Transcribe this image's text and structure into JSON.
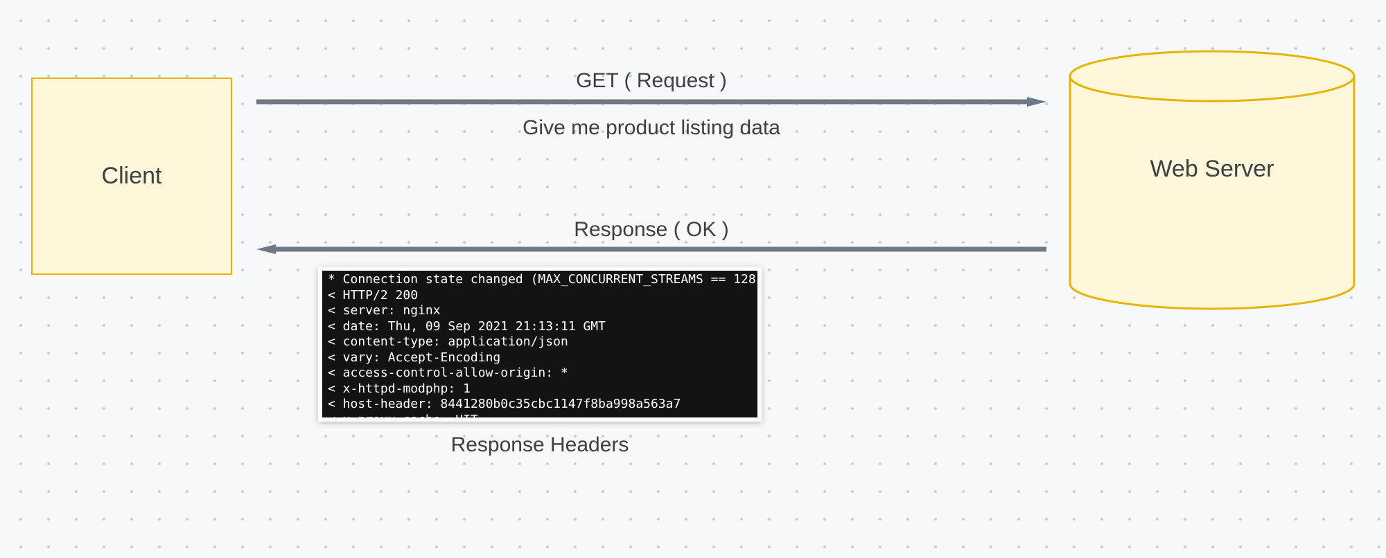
{
  "client": {
    "label": "Client"
  },
  "server": {
    "label": "Web Server"
  },
  "request": {
    "top_label": "GET ( Request )",
    "bottom_label": "Give me product listing data"
  },
  "response": {
    "top_label": "Response ( OK )",
    "caption": "Response Headers",
    "headers_text": "* Connection state changed (MAX_CONCURRENT_STREAMS == 128)!\n< HTTP/2 200\n< server: nginx\n< date: Thu, 09 Sep 2021 21:13:11 GMT\n< content-type: application/json\n< vary: Accept-Encoding\n< access-control-allow-origin: *\n< x-httpd-modphp: 1\n< host-header: 8441280b0c35cbc1147f8ba998a563a7\n< x-proxy-cache: HIT\n<"
  }
}
